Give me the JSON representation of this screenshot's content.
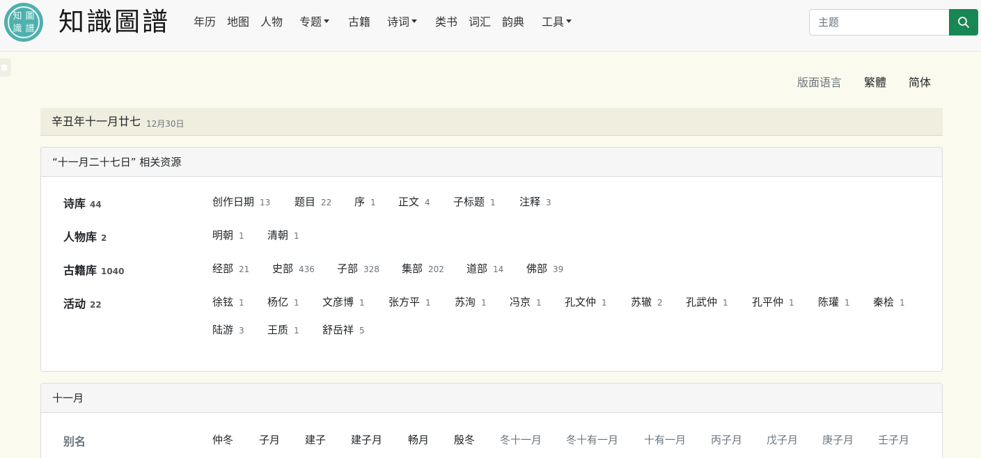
{
  "brand": {
    "title": "知識圖譜",
    "seal_chars": [
      "圖",
      "知",
      "譜",
      "識"
    ]
  },
  "nav": {
    "items": [
      {
        "label": "年历",
        "dropdown": false
      },
      {
        "label": "地图",
        "dropdown": false
      },
      {
        "label": "人物",
        "dropdown": false
      },
      {
        "label": "专题",
        "dropdown": true
      },
      {
        "label": "古籍",
        "dropdown": false
      },
      {
        "label": "诗词",
        "dropdown": true
      },
      {
        "label": "类书",
        "dropdown": false
      },
      {
        "label": "词汇",
        "dropdown": false
      },
      {
        "label": "韵典",
        "dropdown": false
      },
      {
        "label": "工具",
        "dropdown": true
      }
    ],
    "search_placeholder": "主题",
    "search_icon": "search-icon"
  },
  "lang": {
    "label": "版面语言",
    "options": [
      "繁體",
      "简体"
    ]
  },
  "date": {
    "lunar": "辛丑年十一月廿七",
    "gregorian": "12月30日"
  },
  "related": {
    "title": "“十一月二十七日” 相关资源",
    "rows": [
      {
        "label": "诗库",
        "count": "44",
        "items": [
          {
            "name": "创作日期",
            "count": "13"
          },
          {
            "name": "题目",
            "count": "22"
          },
          {
            "name": "序",
            "count": "1"
          },
          {
            "name": "正文",
            "count": "4"
          },
          {
            "name": "子标题",
            "count": "1"
          },
          {
            "name": "注释",
            "count": "3"
          }
        ]
      },
      {
        "label": "人物库",
        "count": "2",
        "items": [
          {
            "name": "明朝",
            "count": "1"
          },
          {
            "name": "清朝",
            "count": "1"
          }
        ]
      },
      {
        "label": "古籍库",
        "count": "1040",
        "items": [
          {
            "name": "经部",
            "count": "21"
          },
          {
            "name": "史部",
            "count": "436"
          },
          {
            "name": "子部",
            "count": "328"
          },
          {
            "name": "集部",
            "count": "202"
          },
          {
            "name": "道部",
            "count": "14"
          },
          {
            "name": "佛部",
            "count": "39"
          }
        ]
      },
      {
        "label": "活动",
        "count": "22",
        "items": [
          {
            "name": "徐铉",
            "count": "1"
          },
          {
            "name": "杨亿",
            "count": "1"
          },
          {
            "name": "文彦博",
            "count": "1"
          },
          {
            "name": "张方平",
            "count": "1"
          },
          {
            "name": "苏洵",
            "count": "1"
          },
          {
            "name": "冯京",
            "count": "1"
          },
          {
            "name": "孔文仲",
            "count": "1"
          },
          {
            "name": "苏辙",
            "count": "2"
          },
          {
            "name": "孔武仲",
            "count": "1"
          },
          {
            "name": "孔平仲",
            "count": "1"
          },
          {
            "name": "陈瓘",
            "count": "1"
          },
          {
            "name": "秦桧",
            "count": "1"
          },
          {
            "name": "陆游",
            "count": "3"
          },
          {
            "name": "王质",
            "count": "1"
          },
          {
            "name": "舒岳祥",
            "count": "5"
          }
        ]
      }
    ]
  },
  "month": {
    "title": "十一月",
    "alias_label": "别名",
    "aliases": [
      {
        "name": "仲冬",
        "muted": false
      },
      {
        "name": "子月",
        "muted": false
      },
      {
        "name": "建子",
        "muted": false
      },
      {
        "name": "建子月",
        "muted": false
      },
      {
        "name": "畅月",
        "muted": false
      },
      {
        "name": "殷冬",
        "muted": false
      },
      {
        "name": "冬十一月",
        "muted": true
      },
      {
        "name": "冬十有一月",
        "muted": true
      },
      {
        "name": "十有一月",
        "muted": true
      },
      {
        "name": "丙子月",
        "muted": true
      },
      {
        "name": "戊子月",
        "muted": true
      },
      {
        "name": "庚子月",
        "muted": true
      },
      {
        "name": "壬子月",
        "muted": true
      }
    ]
  },
  "colors": {
    "accent": "#198754",
    "seal": "#4fb0ad",
    "background": "#fbfaee"
  }
}
